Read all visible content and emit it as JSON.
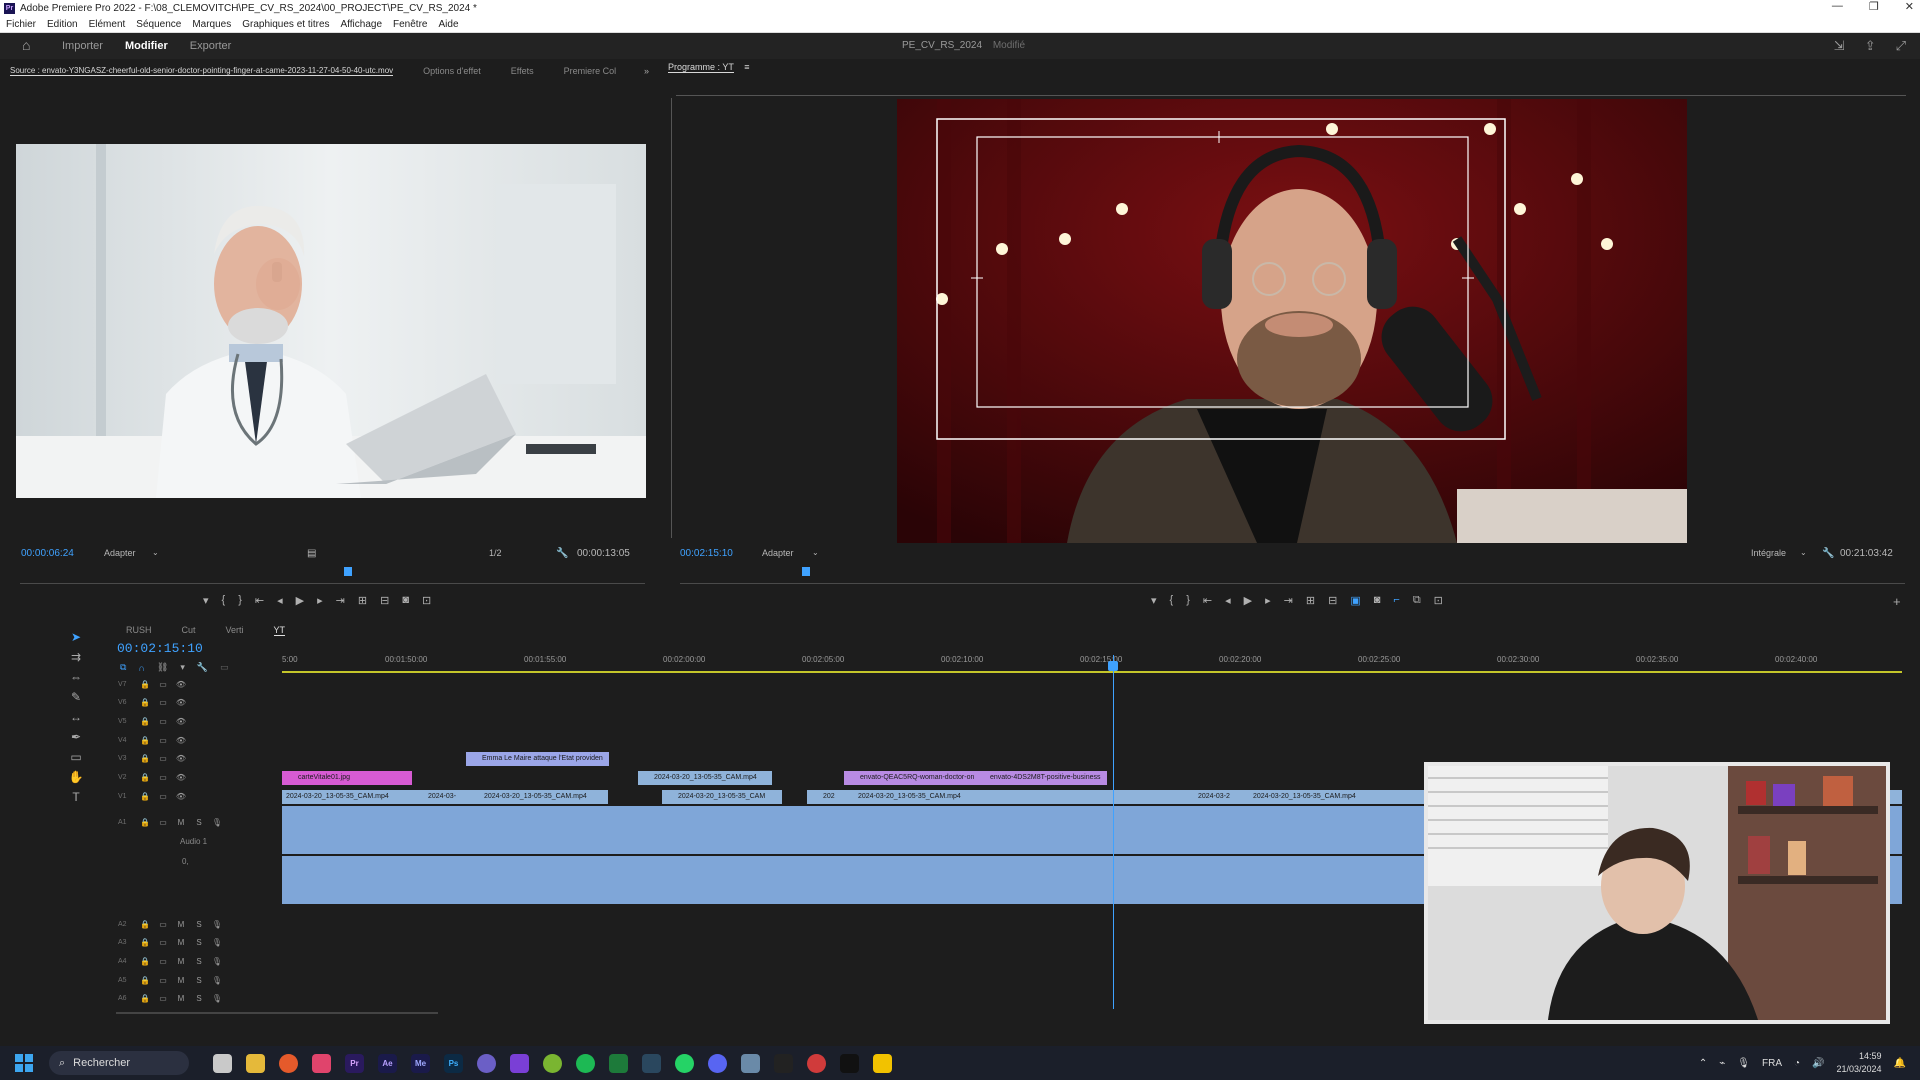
{
  "window": {
    "title": "Adobe Premiere Pro 2022 - F:\\08_CLEMOVITCH\\PE_CV_RS_2024\\00_PROJECT\\PE_CV_RS_2024 *",
    "logo": "Pr",
    "controls": [
      "—",
      "❐",
      "✕"
    ]
  },
  "menu": [
    "Fichier",
    "Edition",
    "Elément",
    "Séquence",
    "Marques",
    "Graphiques et titres",
    "Affichage",
    "Fenêtre",
    "Aide"
  ],
  "workspace": {
    "tabs": [
      "Importer",
      "Modifier",
      "Exporter"
    ],
    "active_tab": "Modifier",
    "project_name": "PE_CV_RS_2024",
    "status": "Modifié"
  },
  "source_panel": {
    "tabs": [
      "Source : envato-Y3NGASZ-cheerful-old-senior-doctor-pointing-finger-at-came-2023-11-27-04-50-40-utc.mov",
      "Options d'effet",
      "Effets",
      "Premiere Col"
    ],
    "timecode": "00:00:06:24",
    "fit": "Adapter",
    "resolution": "1/2",
    "duration": "00:00:13:05"
  },
  "program_panel": {
    "title": "Programme : YT",
    "timecode": "00:02:15:10",
    "fit": "Adapter",
    "quality": "Intégrale",
    "duration": "00:21:03:42"
  },
  "timeline": {
    "tabs": [
      "RUSH",
      "Cut",
      "Verti",
      "YT"
    ],
    "active_tab": "YT",
    "timecode": "00:02:15:10",
    "ruler": [
      "5:00",
      "00:01:50:00",
      "00:01:55:00",
      "00:02:00:00",
      "00:02:05:00",
      "00:02:10:00",
      "00:02:15:00",
      "00:02:20:00",
      "00:02:25:00",
      "00:02:30:00",
      "00:02:35:00",
      "00:02:40:00"
    ],
    "video_tracks": [
      "V7",
      "V6",
      "V5",
      "V4",
      "V3",
      "V2",
      "V1"
    ],
    "audio_tracks": [
      "A1",
      "A2",
      "A3",
      "A4",
      "A5",
      "A6"
    ],
    "audio_label": "Audio 1",
    "audio_level": "0,",
    "clips": {
      "v3": "Emma Le Maire attaque l'Etat providen",
      "v2_a": "carteVitale01.jpg",
      "v2_b": "2024-03-20_13-05-35_CAM.mp4",
      "v2_c": "envato-QEAC5RQ-woman-doctor-on",
      "v2_d": "envato-4DS2M8T-positive-business",
      "v1_a": "2024-03-20_13-05-35_CAM.mp4",
      "v1_b": "2024-03-",
      "v1_c": "2024-03-20_13-05-35_CAM.mp4",
      "v1_d": "2024-03-20_13-05-35_CAM",
      "v1_e": "202",
      "v1_f": "2024-03-20_13-05-35_CAM.mp4",
      "v1_g": "2024-03-2",
      "v1_h": "2024-03-20_13-05-35_CAM.mp4"
    }
  },
  "taskbar": {
    "search": "Rechercher",
    "lang": "FRA",
    "time": "14:59",
    "date": "21/03/2024"
  },
  "colors": {
    "accent": "#3fa2ff",
    "clip_video": "#8fb3da",
    "clip_pink": "#d75bd3",
    "clip_violet": "#b88be3",
    "work_area": "#c4c62a"
  }
}
